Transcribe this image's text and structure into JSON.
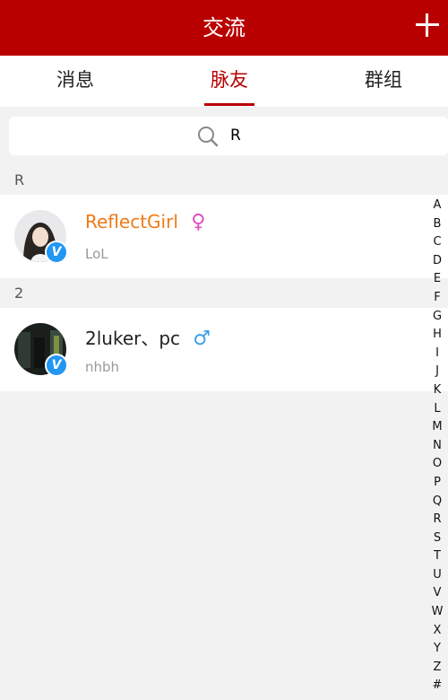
{
  "header": {
    "title": "交流"
  },
  "tabs": [
    {
      "label": "消息",
      "active": false
    },
    {
      "label": "脉友",
      "active": true
    },
    {
      "label": "群组",
      "active": false
    }
  ],
  "search": {
    "value": "R"
  },
  "sections": [
    {
      "letter": "R",
      "contacts": [
        {
          "name": "ReflectGirl",
          "gender_symbol": "♀",
          "subtitle": "LoL",
          "badge": "V"
        }
      ]
    },
    {
      "letter": "2",
      "contacts": [
        {
          "name": "2luker、pc",
          "gender_symbol": "♂",
          "subtitle": "nhbh",
          "badge": "V"
        }
      ]
    }
  ],
  "index_letters": [
    "A",
    "B",
    "C",
    "D",
    "E",
    "F",
    "G",
    "H",
    "I",
    "J",
    "K",
    "L",
    "M",
    "N",
    "O",
    "P",
    "Q",
    "R",
    "S",
    "T",
    "U",
    "V",
    "W",
    "X",
    "Y",
    "Z",
    "#"
  ],
  "colors": {
    "brand": "#b80000",
    "name_highlight": "#f07a18",
    "female": "#e04dc0",
    "male": "#3aa0e8",
    "badge": "#2196f3"
  }
}
